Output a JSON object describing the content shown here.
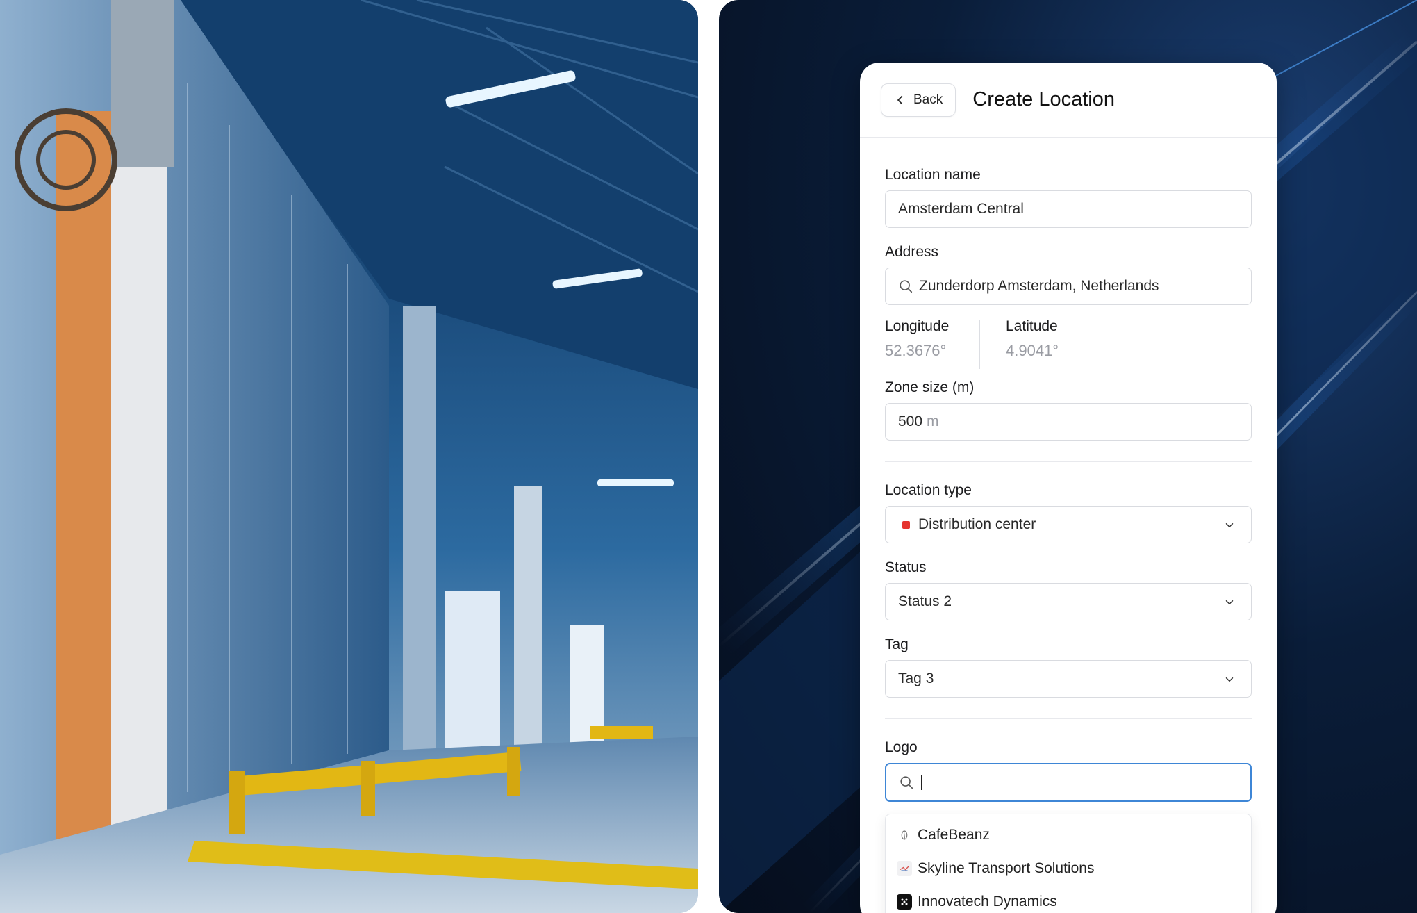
{
  "header": {
    "back_label": "Back",
    "title": "Create Location"
  },
  "form": {
    "location_name": {
      "label": "Location name",
      "value": "Amsterdam Central"
    },
    "address": {
      "label": "Address",
      "value": "Zunderdorp Amsterdam, Netherlands"
    },
    "longitude": {
      "label": "Longitude",
      "value": "52.3676°"
    },
    "latitude": {
      "label": "Latitude",
      "value": "4.9041°"
    },
    "zone_size": {
      "label": "Zone size (m)",
      "value": "500",
      "unit": "m"
    },
    "location_type": {
      "label": "Location type",
      "value": "Distribution center",
      "color": "#e5342f"
    },
    "status": {
      "label": "Status",
      "value": "Status 2"
    },
    "tag": {
      "label": "Tag",
      "value": "Tag 3"
    },
    "logo": {
      "label": "Logo",
      "search_value": "",
      "options": [
        {
          "name": "CafeBeanz",
          "icon": "coffee-bean-icon"
        },
        {
          "name": "Skyline Transport Solutions",
          "icon": "skyline-logo-icon"
        },
        {
          "name": "Innovatech Dynamics",
          "icon": "innovatech-logo-icon"
        }
      ]
    }
  },
  "colors": {
    "accent_focus": "#3e86d6",
    "panel_dark": "#0a1d39"
  }
}
